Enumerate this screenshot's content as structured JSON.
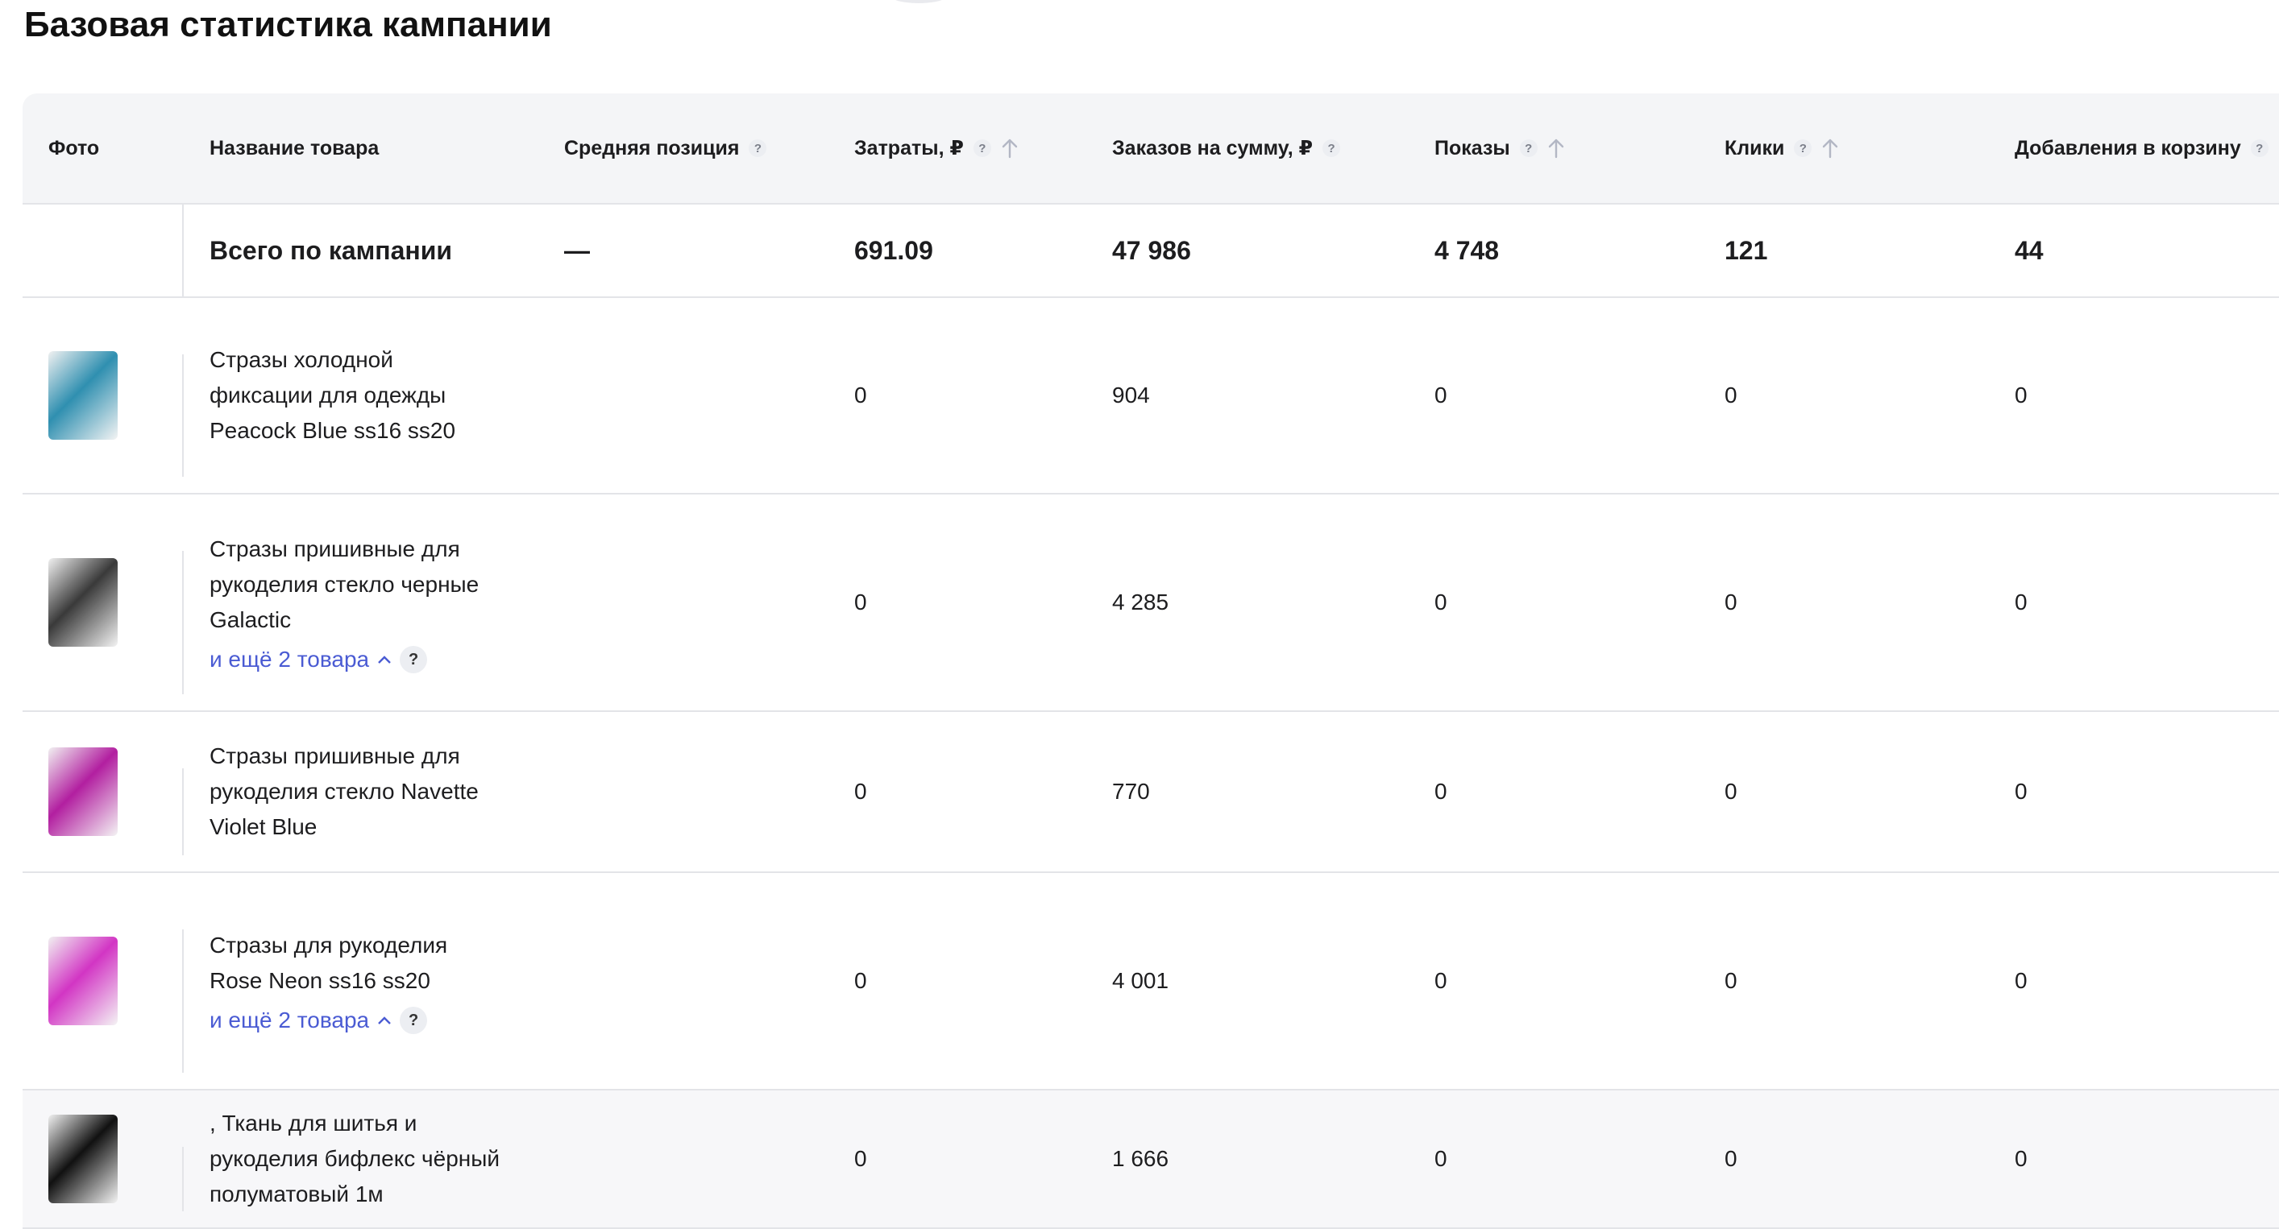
{
  "page": {
    "title": "Базовая статистика кампании"
  },
  "columns": [
    {
      "key": "photo",
      "label": "Фото",
      "help": false,
      "sort": false
    },
    {
      "key": "name",
      "label": "Название товара",
      "help": false,
      "sort": false
    },
    {
      "key": "avg_pos",
      "label": "Средняя позиция",
      "help": true,
      "sort": false
    },
    {
      "key": "spend",
      "label": "Затраты, ₽",
      "help": true,
      "sort": true
    },
    {
      "key": "orders_sum",
      "label": "Заказов на сумму, ₽",
      "help": true,
      "sort": false
    },
    {
      "key": "impressions",
      "label": "Показы",
      "help": true,
      "sort": true
    },
    {
      "key": "clicks",
      "label": "Клики",
      "help": true,
      "sort": true
    },
    {
      "key": "cart_adds",
      "label": "Добавления в корзину",
      "help": true,
      "sort": false
    }
  ],
  "help_glyph": "?",
  "total": {
    "label": "Всего по кампании",
    "avg_pos": "—",
    "spend": "691.09",
    "orders_sum": "47 986",
    "impressions": "4 748",
    "clicks": "121",
    "cart_adds": "44"
  },
  "rows": [
    {
      "name": "Стразы холодной фиксации для одежды Peacock Blue ss16 ss20",
      "thumb_color": "#2f8fb0",
      "more": null,
      "spend": "0",
      "orders_sum": "904",
      "impressions": "0",
      "clicks": "0",
      "cart_adds": "0"
    },
    {
      "name": "Стразы пришивные для рукоделия стекло черные Galactic",
      "thumb_color": "#3a3a3a",
      "more": "и ещё 2 товара",
      "spend": "0",
      "orders_sum": "4 285",
      "impressions": "0",
      "clicks": "0",
      "cart_adds": "0"
    },
    {
      "name": "Стразы пришивные для рукоделия стекло Navette Violet Blue",
      "thumb_color": "#b21fa0",
      "more": null,
      "spend": "0",
      "orders_sum": "770",
      "impressions": "0",
      "clicks": "0",
      "cart_adds": "0"
    },
    {
      "name": "Стразы для рукоделия Rose Neon ss16 ss20",
      "thumb_color": "#d235c4",
      "more": "и ещё 2 товара",
      "spend": "0",
      "orders_sum": "4 001",
      "impressions": "0",
      "clicks": "0",
      "cart_adds": "0"
    },
    {
      "name": ", Ткань для шитья и рукоделия бифлекс чёрный полуматовый 1м",
      "thumb_color": "#111111",
      "more": null,
      "spend": "0",
      "orders_sum": "1 666",
      "impressions": "0",
      "clicks": "0",
      "cart_adds": "0"
    }
  ]
}
